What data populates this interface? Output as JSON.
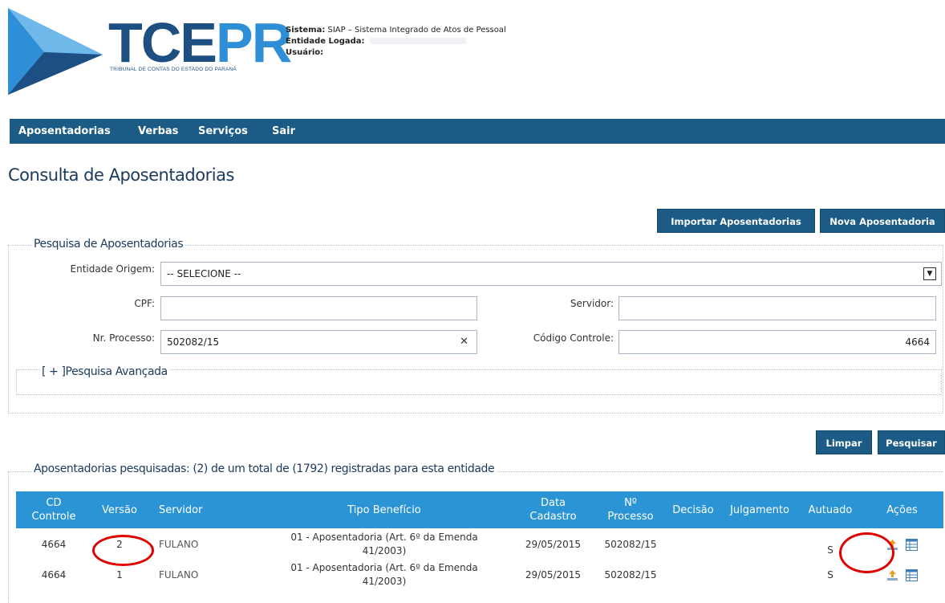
{
  "header": {
    "logo_main_a": "TCE",
    "logo_main_b": "PR",
    "logo_sub": "TRIBUNAL DE CONTAS DO ESTADO DO PARANÁ",
    "sistema_label": "Sistema:",
    "sistema_value": "SIAP – Sistema Integrado de Atos de Pessoal",
    "entidade_label": "Entidade Logada:",
    "usuario_label": "Usuário:"
  },
  "menu": {
    "items": [
      "Aposentadorias",
      "Verbas",
      "Serviços",
      "Sair"
    ]
  },
  "page": {
    "title": "Consulta de Aposentadorias"
  },
  "actions": {
    "import_label": "Importar Aposentadorias",
    "new_label": "Nova Aposentadoria",
    "clear_label": "Limpar",
    "search_label": "Pesquisar"
  },
  "search": {
    "legend": "Pesquisa de Aposentadorias",
    "entidade_label": "Entidade Origem:",
    "entidade_value": "-- SELECIONE --",
    "cpf_label": "CPF:",
    "cpf_value": "",
    "servidor_label": "Servidor:",
    "servidor_value": "",
    "processo_label": "Nr. Processo:",
    "processo_value": "502082/15",
    "codigo_label": "Código Controle:",
    "codigo_value": "4664",
    "advanced_label": "[ + ]Pesquisa Avançada"
  },
  "results": {
    "legend": "Aposentadorias pesquisadas: (2) de um total de (1792) registradas para esta entidade",
    "columns": {
      "cd_1": "CD",
      "cd_2": "Controle",
      "versao": "Versão",
      "servidor": "Servidor",
      "tipo": "Tipo Benefício",
      "data_1": "Data",
      "data_2": "Cadastro",
      "processo_1": "Nº",
      "processo_2": "Processo",
      "decisao": "Decisão",
      "julgamento": "Julgamento",
      "autuado": "Autuado",
      "acoes": "Ações"
    },
    "rows": [
      {
        "cd": "4664",
        "versao": "2",
        "servidor": "FULANO",
        "tipo_1": "01 - Aposentadoria (Art. 6º da Emenda",
        "tipo_2": "41/2003)",
        "data": "29/05/2015",
        "processo": "502082/15",
        "decisao": "",
        "julgamento": "",
        "autuado": "S"
      },
      {
        "cd": "4664",
        "versao": "1",
        "servidor": "FULANO",
        "tipo_1": "01 - Aposentadoria (Art. 6º da Emenda",
        "tipo_2": "41/2003)",
        "data": "29/05/2015",
        "processo": "502082/15",
        "decisao": "",
        "julgamento": "",
        "autuado": "S"
      }
    ]
  },
  "icons": {
    "export": "upload-icon",
    "details": "grid-icon"
  },
  "colors": {
    "primary": "#1b5b85",
    "table_header": "#2b94d4",
    "highlight": "#e00000"
  }
}
